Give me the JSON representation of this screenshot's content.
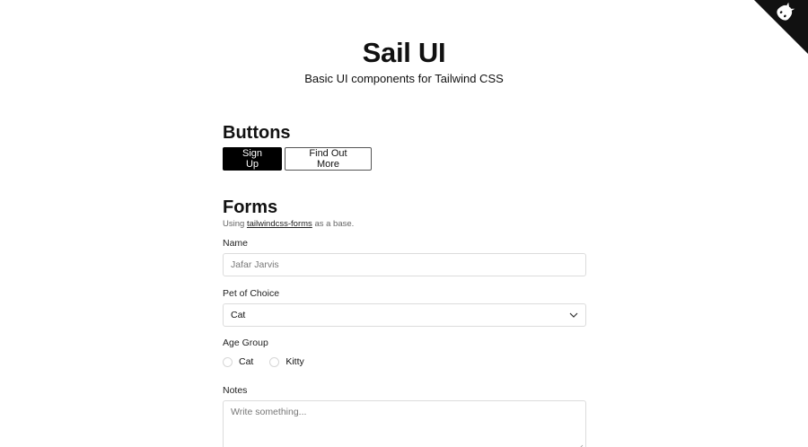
{
  "hero": {
    "title": "Sail UI",
    "subtitle": "Basic UI components for Tailwind CSS"
  },
  "corner": {
    "icon": "github-icon",
    "background": "#111111"
  },
  "buttons_section": {
    "title": "Buttons",
    "primary_label": "Sign Up",
    "secondary_label": "Find Out More"
  },
  "forms_section": {
    "title": "Forms",
    "subtext_prefix": "Using",
    "subtext_link": "tailwindcss-forms",
    "subtext_suffix": "as a base.",
    "name": {
      "label": "Name",
      "placeholder": "Jafar Jarvis"
    },
    "pet": {
      "label": "Pet of Choice",
      "selected": "Cat"
    },
    "age_group": {
      "label": "Age Group",
      "options": [
        "Cat",
        "Kitty"
      ]
    },
    "notes": {
      "label": "Notes",
      "placeholder": "Write something..."
    }
  }
}
